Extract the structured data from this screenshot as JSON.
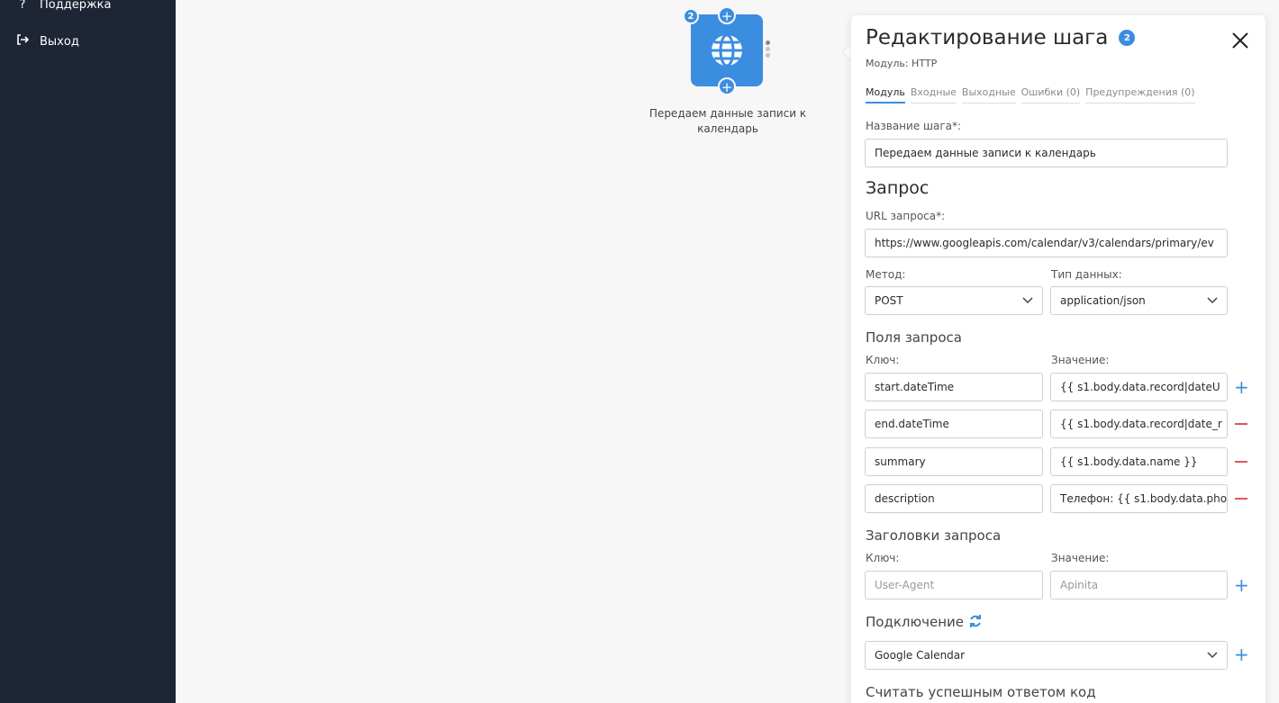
{
  "sidebar": {
    "items": [
      {
        "icon": "question-icon",
        "glyph": "?",
        "label": "Поддержка"
      },
      {
        "icon": "logout-icon",
        "glyph": "[→",
        "label": "Выход"
      }
    ]
  },
  "canvas": {
    "node": {
      "badge": "2",
      "label": "Передаем данные записи к календарь",
      "icon": "globe-icon"
    }
  },
  "panel": {
    "title": "Редактирование шага",
    "title_badge": "2",
    "module": "Модуль: HTTP",
    "tabs": [
      {
        "label": "Модуль",
        "active": true
      },
      {
        "label": "Входные",
        "active": false
      },
      {
        "label": "Выходные",
        "active": false
      },
      {
        "label": "Ошибки (0)",
        "active": false
      },
      {
        "label": "Предупреждения (0)",
        "active": false
      }
    ],
    "step_name_label": "Название шага*:",
    "step_name_value": "Передаем данные записи к календарь",
    "request_heading": "Запрос",
    "url_label": "URL запроса*:",
    "url_value": "https://www.googleapis.com/calendar/v3/calendars/primary/ev",
    "method_label": "Метод:",
    "method_value": "POST",
    "datatype_label": "Тип данных:",
    "datatype_value": "application/json",
    "fields_heading": "Поля запроса",
    "key_label": "Ключ:",
    "value_label": "Значение:",
    "fields": [
      {
        "key": "start.dateTime",
        "value": "{{ s1.body.data.record|dateU"
      },
      {
        "key": "end.dateTime",
        "value": "{{ s1.body.data.record|date_r"
      },
      {
        "key": "summary",
        "value": "{{ s1.body.data.name }}"
      },
      {
        "key": "description",
        "value": "Телефон: {{ s1.body.data.pho"
      }
    ],
    "headers_heading": "Заголовки запроса",
    "headers_key_label": "Ключ:",
    "headers_value_label": "Значение:",
    "header_key_placeholder": "User-Agent",
    "header_value_placeholder": "Apinita",
    "connection_heading": "Подключение",
    "connection_value": "Google Calendar",
    "success_code_heading": "Считать успешным ответом код"
  },
  "colors": {
    "accent": "#3b8de0",
    "sidebar": "#1e2535",
    "danger": "#e25555"
  }
}
